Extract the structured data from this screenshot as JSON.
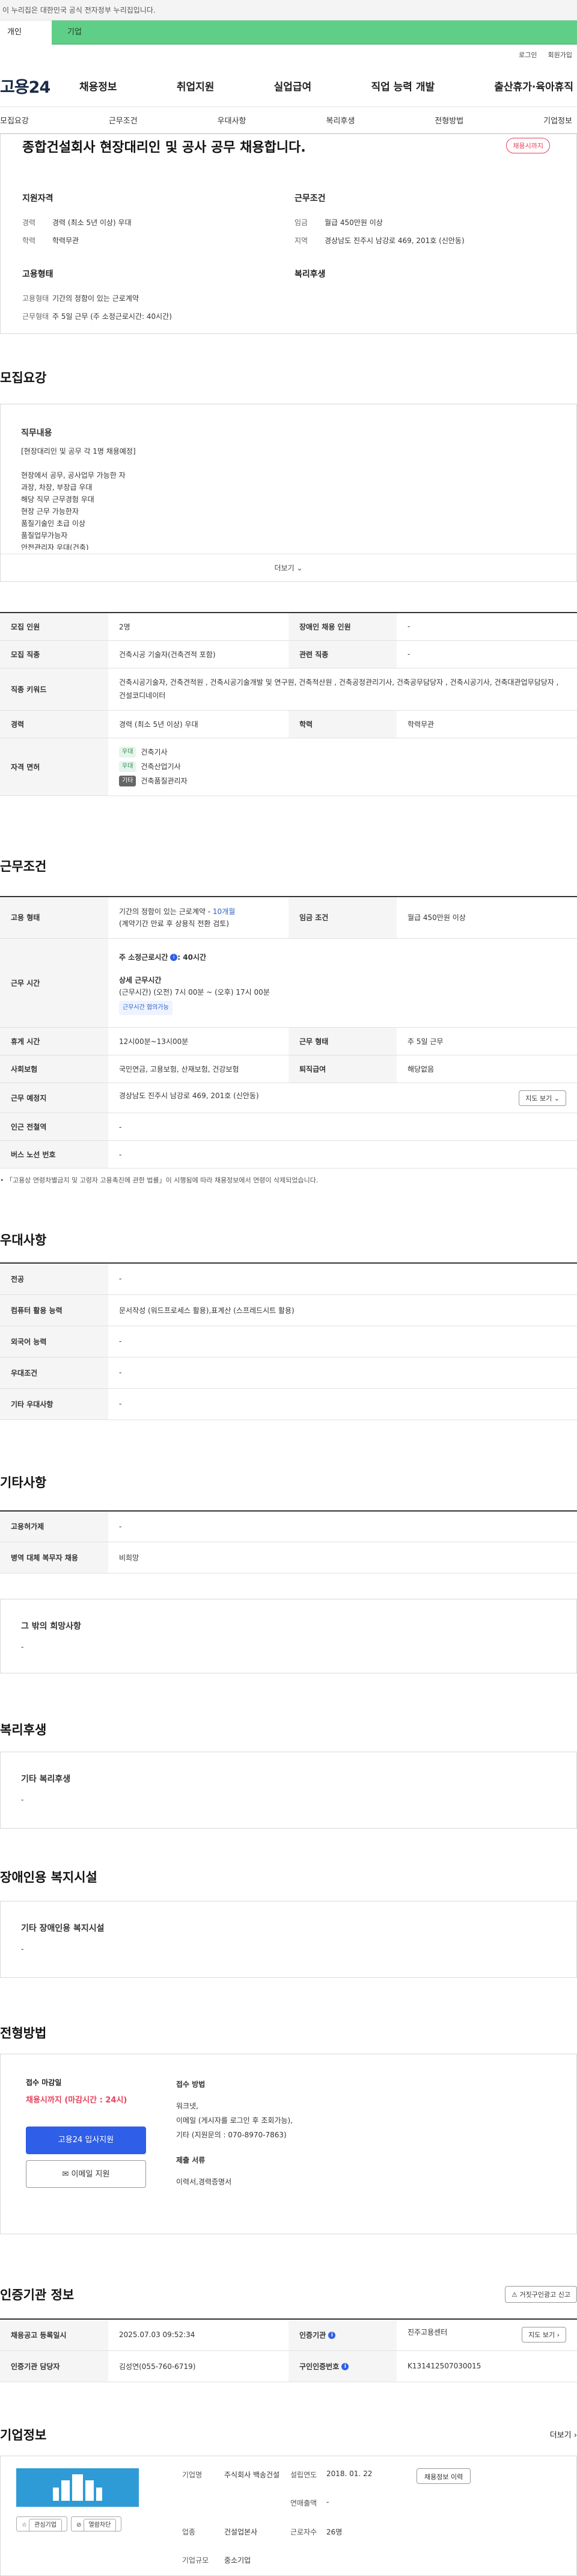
{
  "banner": {
    "text": "이 누리집은 대한민국 공식 전자정부 누리집입니다."
  },
  "topTabs": [
    {
      "label": "개인"
    },
    {
      "label": "기업"
    }
  ],
  "util": {
    "login": "로그인",
    "signup": "회원가입"
  },
  "gnb": {
    "logo": "고용24",
    "menu": [
      "채용정보",
      "취업지원",
      "실업급여",
      "직업 능력 개발",
      "출산휴가·육아휴직"
    ]
  },
  "subnav": [
    "모집요강",
    "근무조건",
    "우대사항",
    "복리후생",
    "전형방법",
    "기업정보"
  ],
  "summary": {
    "title": "종합건설회사 현장대리인 및 공사 공무 채용합니다.",
    "deadlineBadge": "채용시까지",
    "qualTitle": "지원자격",
    "qual": [
      {
        "k": "경력",
        "v": "경력 (최소 5년 이상) 우대"
      },
      {
        "k": "학력",
        "v": "학력무관"
      }
    ],
    "empTitle": "고용형태",
    "emp": [
      {
        "k": "고용형태",
        "v": "기간의 정함이 있는 근로계약"
      },
      {
        "k": "근무형태",
        "v": "주 5일 근무 (주 소정근로시간: 40시간)"
      }
    ],
    "condTitle": "근무조건",
    "cond": [
      {
        "k": "임금",
        "v": "월급 450만원 이상"
      },
      {
        "k": "지역",
        "v": "경상남도 진주시 남강로 469, 201호 (신안동)"
      }
    ],
    "welfareTitle": "복리후생"
  },
  "recruit": {
    "sectionTitle": "모집요강",
    "descTitle": "직무내용",
    "descLines": [
      "[현장대리인 및 공무 각 1명 채용예정]",
      "",
      "현장에서 공무, 공사업무 가능한 자",
      "과장, 차장, 부장급 우대",
      "해당 직무 근무경험 우대",
      "현장 근무 가능한자",
      "품질기술인 초급 이상",
      "품질업무가능자",
      "안전관리자 우대(건축)"
    ],
    "more": "더보기",
    "rows": {
      "count_k": "모집 인원",
      "count_v": "2명",
      "disabled_k": "장애인 채용 인원",
      "disabled_v": "-",
      "job_k": "모집 직종",
      "job_v": "건축시공 기술자(건축견적 포함)",
      "related_k": "관련 직종",
      "related_v": "-",
      "kw_k": "직종 키워드",
      "kw_v": "건축시공기술자, 건축견적원 , 건축시공기술개발 및 연구원, 건축적산원 , 건축공정관리기사, 건축공무담당자 , 건축시공기사, 건축대관업무담당자 , 건설코디네이터",
      "career_k": "경력",
      "career_v": "경력 (최소 5년 이상) 우대",
      "edu_k": "학력",
      "edu_v": "학력무관",
      "license_k": "자격 면허",
      "licenses": [
        {
          "tag": "우대",
          "name": "건축기사"
        },
        {
          "tag": "우대",
          "name": "건축산업기사"
        },
        {
          "tag": "기타",
          "name": "건축품질관리자"
        }
      ]
    }
  },
  "work": {
    "sectionTitle": "근무조건",
    "type_k": "고용 형태",
    "type_v": "기간의 정함이 있는 근로계약 - ",
    "type_link": "10개월",
    "type_sub": "(계약기간 만료 후 상용직 전환 검토)",
    "wage_k": "임금 조건",
    "wage_v": "월급 450만원 이상",
    "hours_k": "근무 시간",
    "hours_main": "주 소정근로시간",
    "hours_val": ": 40시간",
    "hours_detail_title": "상세 근무시간",
    "hours_detail": "(근무시간) (오전) 7시 00분 ~ (오후) 17시 00분",
    "hours_btn": "근무시간 협의가능",
    "break_k": "휴게 시간",
    "break_v": "12시00분~13시00분",
    "form_k": "근무 형태",
    "form_v": "주 5일 근무",
    "ins_k": "사회보험",
    "ins_v": "국민연금, 고용보험, 산재보험, 건강보험",
    "sev_k": "퇴직급여",
    "sev_v": "해당없음",
    "place_k": "근무 예정지",
    "place_v": "경상남도 진주시 남강로 469, 201호 (신안동)",
    "map_btn": "지도 보기",
    "station_k": "인근 전철역",
    "station_v": "-",
    "bus_k": "버스 노선 번호",
    "bus_v": "-",
    "note": "「고용상 연령차별금지 및 고령자 고용촉진에 관한 법률」이 시행됨에 따라 채용정보에서 연령이 삭제되었습니다."
  },
  "pref": {
    "sectionTitle": "우대사항",
    "rows": [
      {
        "k": "전공",
        "v": "-"
      },
      {
        "k": "컴퓨터 활용 능력",
        "v": "문서작성 (워드프로세스 활용),표계산 (스프레드시트 활용)"
      },
      {
        "k": "외국어 능력",
        "v": "-"
      },
      {
        "k": "우대조건",
        "v": "-"
      },
      {
        "k": "기타 우대사항",
        "v": "-"
      }
    ]
  },
  "etc": {
    "sectionTitle": "기타사항",
    "rows": [
      {
        "k": "고용허가제",
        "v": "-"
      },
      {
        "k": "병역 대체 복무자 채용",
        "v": "비희망"
      }
    ],
    "otherTitle": "그 밖의 희망사항",
    "otherVal": "-"
  },
  "welfare": {
    "sectionTitle": "복리후생",
    "cardTitle": "기타 복리후생",
    "cardVal": "-"
  },
  "disabled": {
    "sectionTitle": "장애인용 복지시설",
    "cardTitle": "기타 장애인용 복지시설",
    "cardVal": "-"
  },
  "screening": {
    "sectionTitle": "전형방법",
    "deadlineLabel": "접수 마감일",
    "deadlineVal": "채용시까지 (마감시간 : 24시)",
    "applyBtn": "고용24 입사지원",
    "emailBtn": "이메일 지원",
    "methodLabel": "접수 방법",
    "methods": [
      "워크넷,",
      "이메일 (게시자를 로그인 후 조회가능),",
      "기타 (지원문의 : 070-8970-7863)"
    ],
    "docsLabel": "제출 서류",
    "docsVal": "이력서,경력증명서"
  },
  "cert": {
    "sectionTitle": "인증기관 정보",
    "reportBtn": "거짓구인광고 신고",
    "reg_k": "채용공고 등록일시",
    "reg_v": "2025.07.03 09:52:34",
    "agency_k": "인증기관",
    "agency_v": "진주고용센터",
    "agency_btn": "지도 보기",
    "mgr_k": "인증기관 담당자",
    "mgr_v": "김성연(055-760-6719)",
    "no_k": "구인인증번호",
    "no_v": "K131412507030015"
  },
  "company": {
    "sectionTitle": "기업정보",
    "more": "더보기",
    "favBtn": "관심기업",
    "hideBtn": "열람차단",
    "name_k": "기업명",
    "name_v": "주식회사 백송건설",
    "estab_k": "설립연도",
    "estab_v": "2018. 01. 22",
    "sales_k": "연매출액",
    "sales_v": "-",
    "ind_k": "업종",
    "ind_v": "건설업본사",
    "emp_k": "근로자수",
    "emp_v": "26명",
    "size_k": "기업규모",
    "size_v": "중소기업",
    "histBtn": "채용정보 이력"
  },
  "colors": {
    "green": "#5fce86",
    "blue": "#2f5ee8",
    "red": "#e8405b"
  }
}
